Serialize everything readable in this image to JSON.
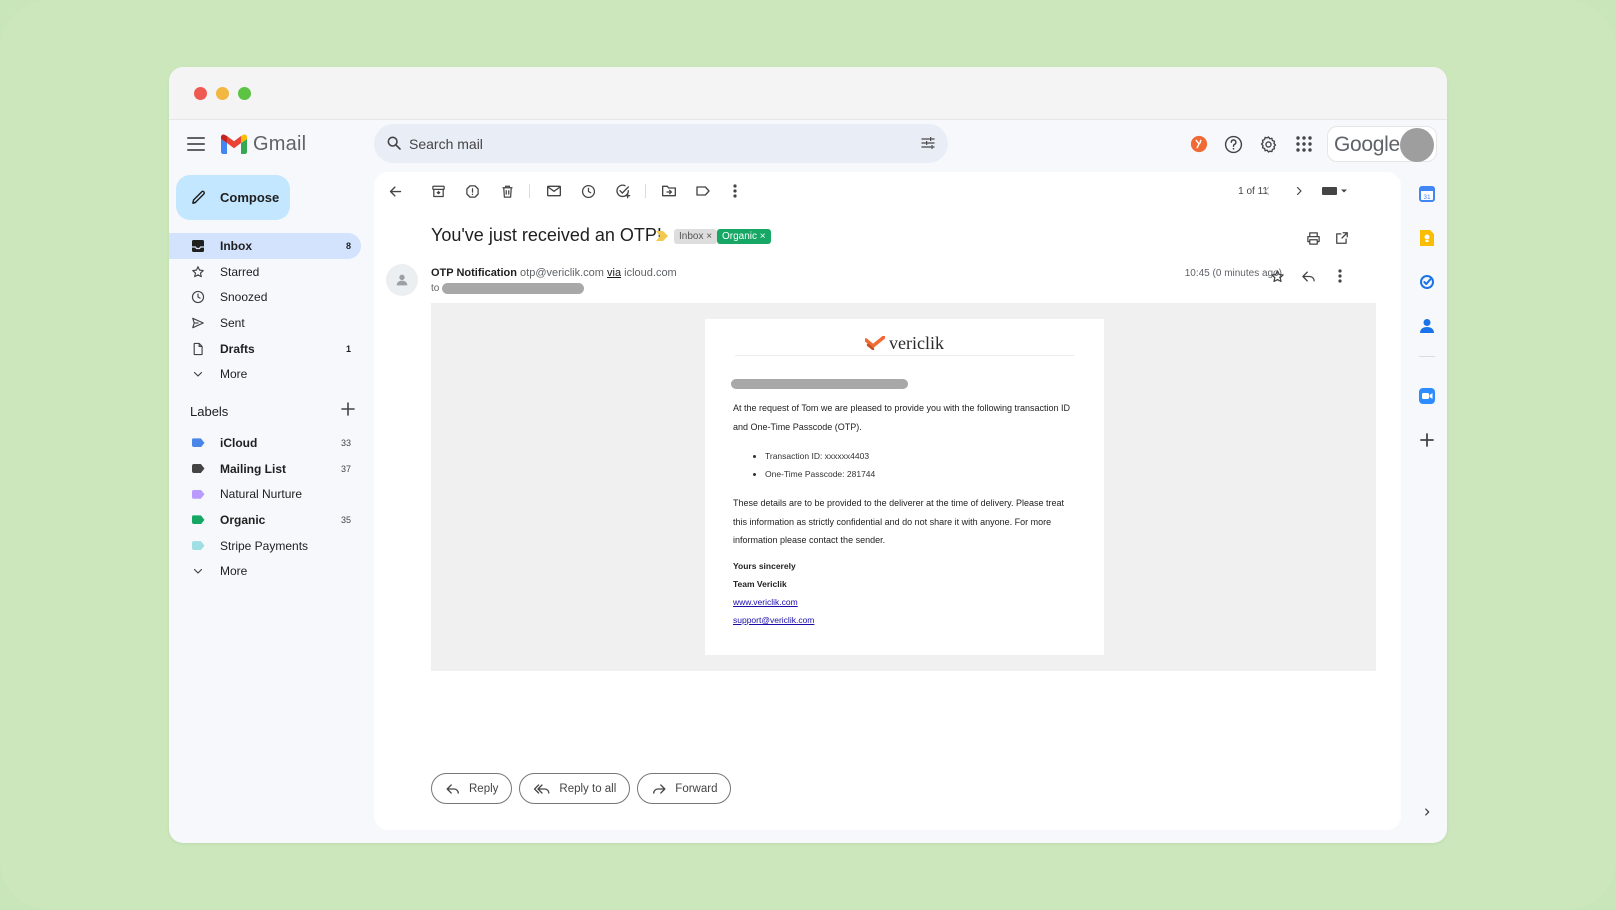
{
  "app": {
    "name": "Gmail",
    "google_wordmark": "Google"
  },
  "search": {
    "placeholder": "Search mail"
  },
  "sidebar": {
    "compose_label": "Compose",
    "items": [
      {
        "label": "Inbox",
        "count": "8",
        "icon": "inbox-icon"
      },
      {
        "label": "Starred",
        "count": "",
        "icon": "star-icon"
      },
      {
        "label": "Snoozed",
        "count": "",
        "icon": "clock-icon"
      },
      {
        "label": "Sent",
        "count": "",
        "icon": "send-icon"
      },
      {
        "label": "Drafts",
        "count": "1",
        "icon": "draft-icon"
      },
      {
        "label": "More",
        "count": "",
        "icon": "chevron-down-icon"
      }
    ],
    "labels_title": "Labels",
    "labels": [
      {
        "label": "iCloud",
        "count": "33",
        "color": "#4a86e8"
      },
      {
        "label": "Mailing List",
        "count": "37",
        "color": "#444444"
      },
      {
        "label": "Natural Nurture",
        "count": "",
        "color": "#b99aff"
      },
      {
        "label": "Organic",
        "count": "35",
        "color": "#16a765"
      },
      {
        "label": "Stripe Payments",
        "count": "",
        "color": "#9fdfe4"
      },
      {
        "label": "More",
        "count": "",
        "color": ""
      }
    ]
  },
  "toolbar": {
    "pager": "1 of 11"
  },
  "message": {
    "subject": "You've just received an OTP!",
    "chips": [
      "Inbox ×",
      "Organic ×"
    ],
    "sender_name": "OTP Notification",
    "sender_email": "otp@vericlik.com",
    "via_word": "via",
    "via_domain": "icloud.com",
    "to_prefix": "to",
    "time": "10:45 (0 minutes ago)"
  },
  "email_body": {
    "brand": "vericlik",
    "intro": "At the request of Tom we are pleased to provide you with the following transaction ID and One-Time Passcode (OTP).",
    "bullets": [
      "Transaction ID: xxxxxx4403",
      "One-Time Passcode: 281744"
    ],
    "details": "These details are to be provided to the deliverer at the time of delivery. Please treat this information as strictly confidential and do not share it with anyone. For more information please contact the sender.",
    "closing": "Yours sincerely",
    "team": "Team Vericlik",
    "website": "www.vericlik.com",
    "support_email": "support@vericlik.com"
  },
  "reply_actions": {
    "reply": "Reply",
    "reply_all": "Reply to all",
    "forward": "Forward"
  },
  "colors": {
    "accent": "#c2e7ff",
    "active_nav": "#d3e3fd",
    "organic_chip": "#16a765",
    "brand_orange": "#f06a35"
  }
}
